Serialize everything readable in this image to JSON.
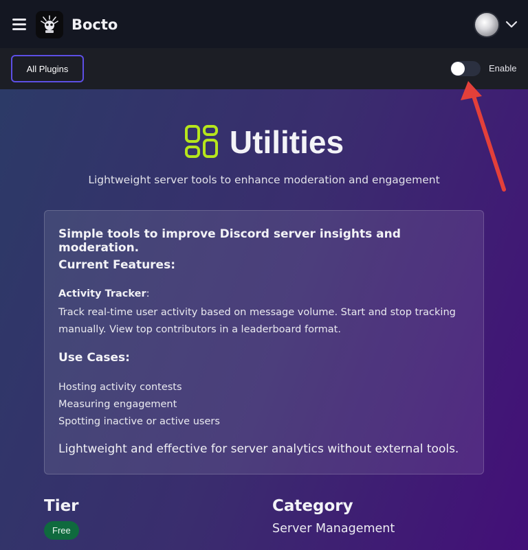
{
  "header": {
    "brand": "Bocto",
    "menu_icon": "hamburger-menu-icon",
    "logo_icon": "bocto-logo-icon",
    "account_icon": "chevron-down-icon"
  },
  "toolbar": {
    "all_plugins_label": "All Plugins",
    "enable_label": "Enable",
    "enabled": false
  },
  "plugin": {
    "icon": "grid-apps-icon",
    "title": "Utilities",
    "subtitle": "Lightweight server tools to enhance moderation and engagement",
    "description": {
      "intro": "Simple tools to improve Discord server insights and moderation.",
      "features_heading": "Current Features:",
      "feature_name": "Activity Tracker",
      "feature_colon": ":",
      "feature_desc": "Track real-time user activity based on message volume. Start and stop tracking manually. View top contributors in a leaderboard format.",
      "use_cases_heading": "Use Cases:",
      "use_cases": [
        "Hosting activity contests",
        "Measuring engagement",
        "Spotting inactive or active users"
      ],
      "closing": "Lightweight and effective for server analytics without external tools."
    },
    "tier_heading": "Tier",
    "tier_value": "Free",
    "category_heading": "Category",
    "category_value": "Server Management"
  },
  "colors": {
    "accent_border": "#5d4fe6",
    "icon_green": "#b6e61c",
    "badge_green": "#0f6a3e",
    "annotation_arrow": "#e4403a"
  }
}
